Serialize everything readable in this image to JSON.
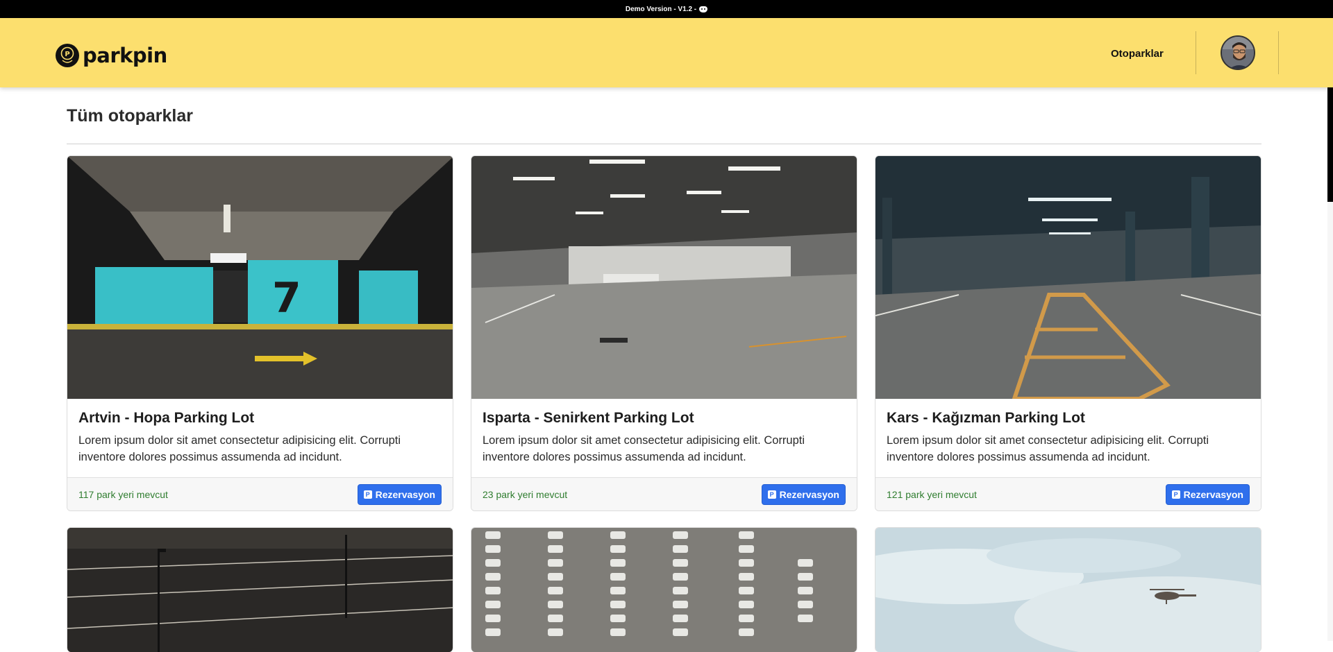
{
  "topbar": {
    "text": "Demo Version - V1.2 -",
    "icon": "discord-icon"
  },
  "navbar": {
    "brand": "parkpin",
    "logo_icon": "parking-pin-icon",
    "links": [
      {
        "label": "Otoparklar"
      }
    ],
    "avatar": "user-avatar"
  },
  "main": {
    "title": "Tüm otoparklar",
    "cards": [
      {
        "title": "Artvin - Hopa Parking Lot",
        "text": "Lorem ipsum dolor sit amet consectetur adipisicing elit. Corrupti inventore dolores possimus assumenda ad incidunt.",
        "availability": "117 park yeri mevcut",
        "button": "Rezervasyon"
      },
      {
        "title": "Isparta - Senirkent Parking Lot",
        "text": "Lorem ipsum dolor sit amet consectetur adipisicing elit. Corrupti inventore dolores possimus assumenda ad incidunt.",
        "availability": "23 park yeri mevcut",
        "button": "Rezervasyon"
      },
      {
        "title": "Kars - Kağızman Parking Lot",
        "text": "Lorem ipsum dolor sit amet consectetur adipisicing elit. Corrupti inventore dolores possimus assumenda ad incidunt.",
        "availability": "121 park yeri mevcut",
        "button": "Rezervasyon"
      },
      {
        "image": "outdoor-parking-lot-night"
      },
      {
        "image": "aerial-cars-parking"
      },
      {
        "image": "sky-helicopter"
      }
    ]
  },
  "colors": {
    "navbar": "#fcdf6e",
    "button": "#2f6fec",
    "available": "#2f7d2f",
    "topbar": "#000000"
  }
}
